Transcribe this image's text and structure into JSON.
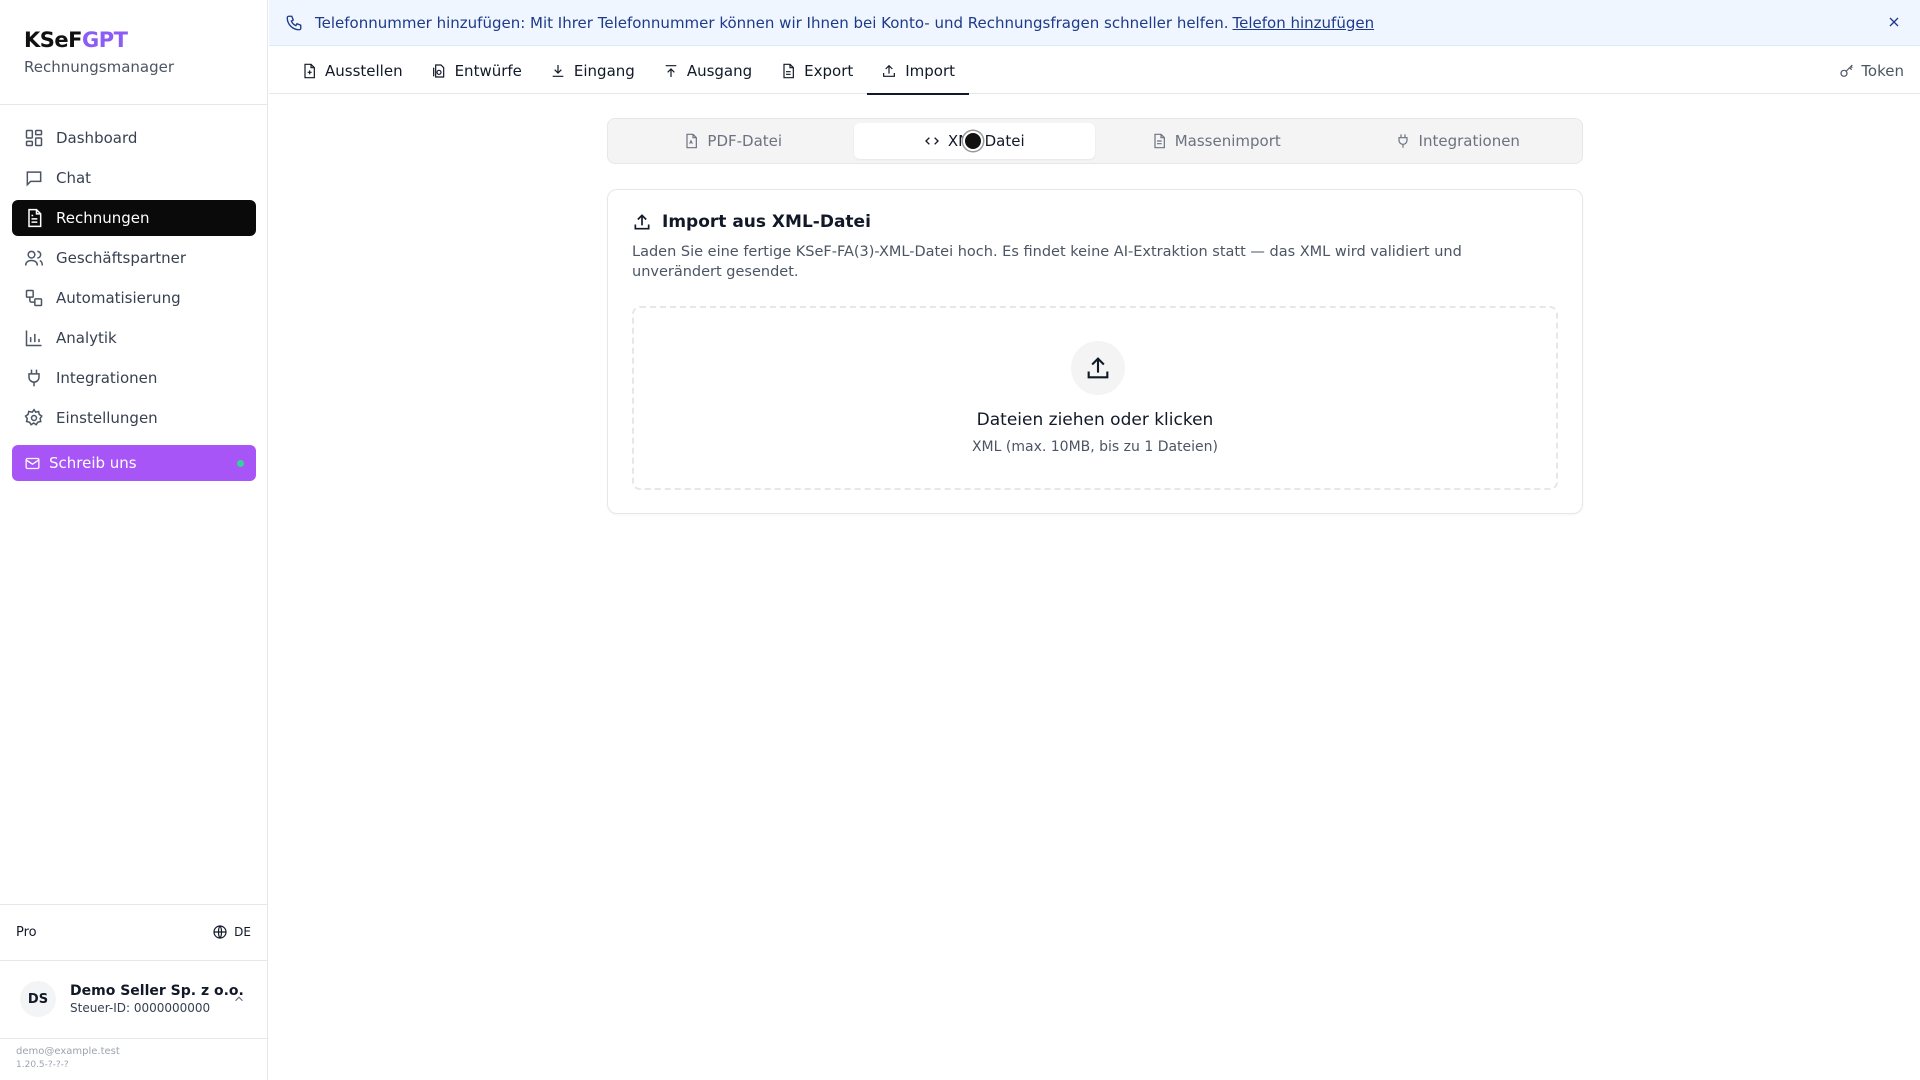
{
  "sidebar": {
    "logo_main": "KSeF",
    "logo_accent": "GPT",
    "subtitle": "Rechnungsmanager",
    "nav": [
      {
        "label": "Dashboard",
        "icon": "dashboard-icon"
      },
      {
        "label": "Chat",
        "icon": "chat-icon"
      },
      {
        "label": "Rechnungen",
        "icon": "invoice-icon",
        "active": true
      },
      {
        "label": "Geschäftspartner",
        "icon": "users-icon"
      },
      {
        "label": "Automatisierung",
        "icon": "workflow-icon"
      },
      {
        "label": "Analytik",
        "icon": "chart-icon"
      },
      {
        "label": "Integrationen",
        "icon": "plug-icon"
      },
      {
        "label": "Einstellungen",
        "icon": "gear-icon"
      }
    ],
    "write_us": "Schreib uns",
    "plan": "Pro",
    "language": "DE",
    "account": {
      "initials": "DS",
      "name": "Demo Seller Sp. z o.o.",
      "tax_id": "Steuer-ID: 0000000000"
    },
    "email": "demo@example.test",
    "version": "1.20.5-?-?-?"
  },
  "banner": {
    "text": "Telefonnummer hinzufügen: Mit Ihrer Telefonnummer können wir Ihnen bei Konto- und Rechnungsfragen schneller helfen.",
    "link": "Telefon hinzufügen"
  },
  "top_tabs": [
    {
      "label": "Ausstellen",
      "icon": "file-plus-icon"
    },
    {
      "label": "Entwürfe",
      "icon": "draft-icon"
    },
    {
      "label": "Eingang",
      "icon": "download-icon"
    },
    {
      "label": "Ausgang",
      "icon": "upload-icon"
    },
    {
      "label": "Export",
      "icon": "file-text-icon"
    },
    {
      "label": "Import",
      "icon": "import-icon",
      "active": true
    }
  ],
  "token_label": "Token",
  "segments": [
    {
      "label": "PDF-Datei",
      "icon": "pdf-file-icon"
    },
    {
      "label": "XML-Datei",
      "icon": "code-icon",
      "active": true
    },
    {
      "label": "Massenimport",
      "icon": "file-stack-icon"
    },
    {
      "label": "Integrationen",
      "icon": "plug-icon"
    }
  ],
  "card": {
    "title": "Import aus XML-Datei",
    "description": "Laden Sie eine fertige KSeF-FA(3)-XML-Datei hoch. Es findet keine AI-Extraktion statt — das XML wird validiert und unverändert gesendet.",
    "dropzone_title": "Dateien ziehen oder klicken",
    "dropzone_sub": "XML (max. 10MB, bis zu 1 Dateien)"
  },
  "colors": {
    "accent": "#a855f7",
    "brand": "#8b5cf6",
    "active_nav": "#0a0a0a",
    "banner_bg": "#eff6ff",
    "banner_text": "#1e3a8a"
  }
}
